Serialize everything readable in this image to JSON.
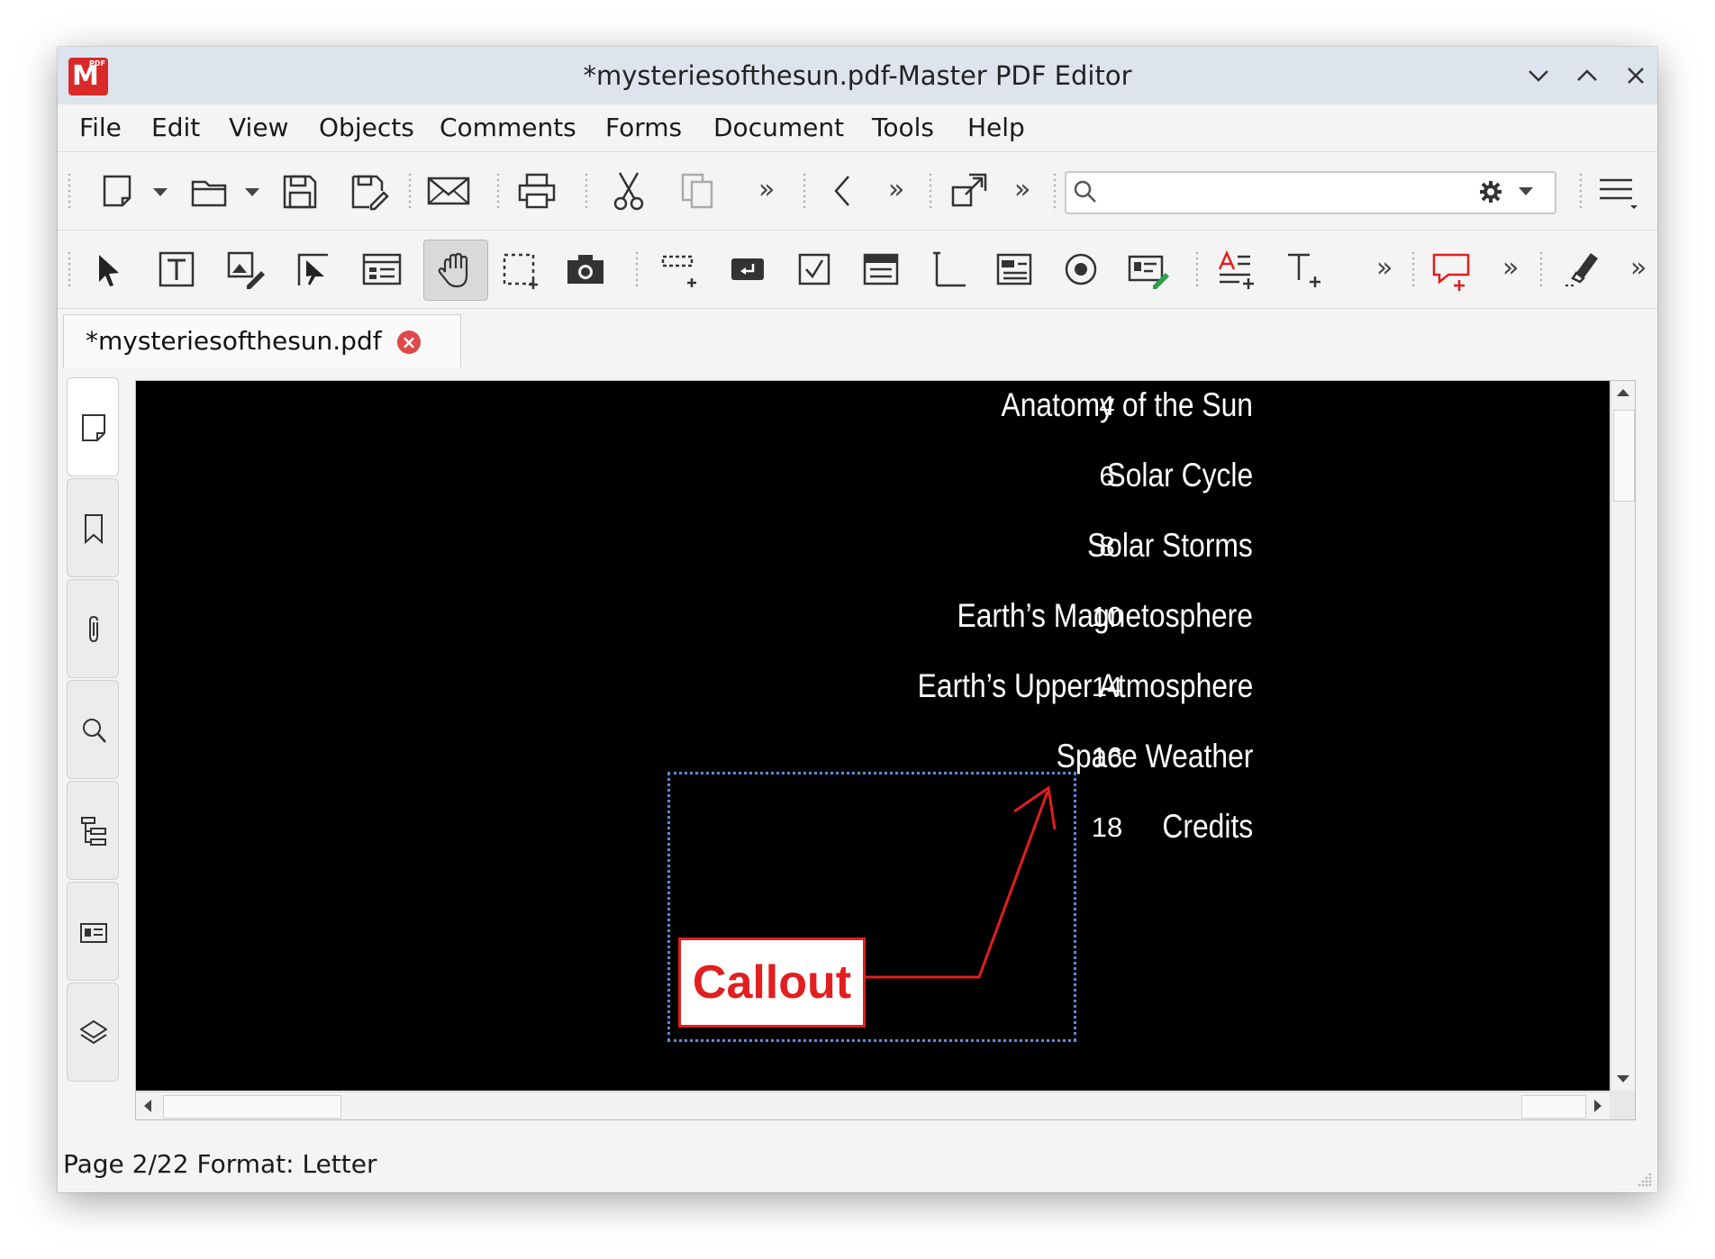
{
  "window": {
    "title": "*mysteriesofthesun.pdf-Master PDF Editor",
    "logo_text": "PDF",
    "logo_mark": "M"
  },
  "menu": [
    "File",
    "Edit",
    "View",
    "Objects",
    "Comments",
    "Forms",
    "Document",
    "Tools",
    "Help"
  ],
  "toolbar": {
    "more_glyph": "»",
    "search_placeholder": "",
    "icons_row1": [
      "new-document-icon",
      "open-folder-icon",
      "save-icon",
      "save-as-icon",
      "email-icon",
      "print-icon",
      "cut-icon",
      "copy-icon",
      "back-icon",
      "fit-icon",
      "search-icon",
      "settings-gear-icon",
      "hamburger-menu-icon"
    ],
    "icons_row2": [
      "select-arrow-icon",
      "edit-text-icon",
      "edit-object-icon",
      "select-object-icon",
      "forms-icon",
      "hand-tool-icon",
      "crop-icon",
      "snapshot-icon",
      "link-icon",
      "button-field-icon",
      "checkbox-field-icon",
      "listbox-field-icon",
      "text-field-icon",
      "combo-field-icon",
      "radio-field-icon",
      "signature-field-icon",
      "text-markup-icon",
      "typewriter-icon",
      "comment-icon",
      "eraser-icon"
    ]
  },
  "tab": {
    "label": "*mysteriesofthesun.pdf",
    "close_glyph": "×"
  },
  "toc": [
    {
      "title": "Anatomy of the Sun",
      "page": "4"
    },
    {
      "title": "Solar Cycle",
      "page": "6"
    },
    {
      "title": "Solar Storms",
      "page": "8"
    },
    {
      "title": "Earth’s Magnetosphere",
      "page": "10"
    },
    {
      "title": "Earth’s Upper Atmosphere",
      "page": "14"
    },
    {
      "title": "Space Weather",
      "page": "16"
    },
    {
      "title": "Credits",
      "page": "18"
    }
  ],
  "callout": {
    "text": "Callout",
    "color": "#e21e1e"
  },
  "status": {
    "text": "Page 2/22 Format: Letter"
  },
  "colors": {
    "accent_red": "#e21e1e",
    "titlebar": "#dde4ee",
    "page_bg": "#000000"
  }
}
